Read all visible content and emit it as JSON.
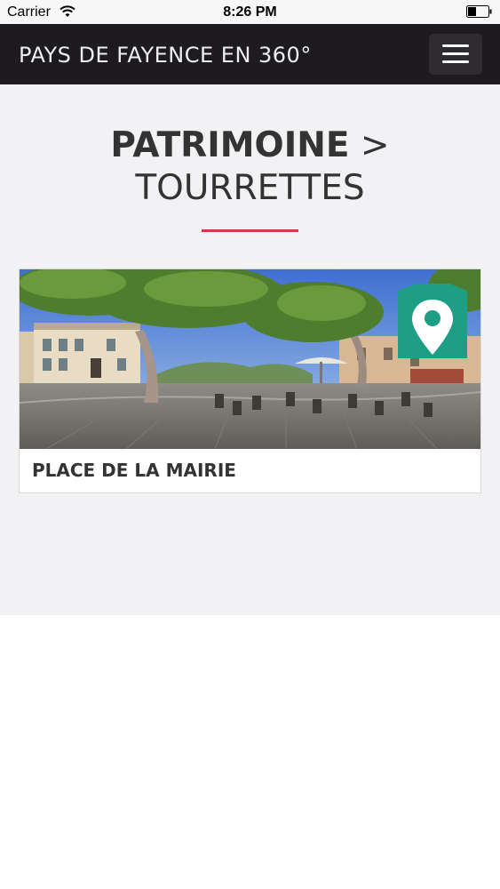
{
  "status_bar": {
    "carrier": "Carrier",
    "time": "8:26 PM",
    "wifi_icon": "wifi-icon",
    "battery_icon": "battery-icon"
  },
  "navbar": {
    "brand": "PAYS DE FAYENCE EN 360°",
    "menu_icon": "hamburger-menu-icon"
  },
  "page": {
    "heading_strong": "PATRIMOINE",
    "heading_separator": " >",
    "heading_sub": "TOURRETTES",
    "accent_color": "#d7364f"
  },
  "cards": [
    {
      "title": "PLACE DE LA MAIRIE",
      "image": "360-panorama-photo",
      "badge_icon": "map-pin-icon",
      "badge_color": "#1f9e86"
    }
  ]
}
